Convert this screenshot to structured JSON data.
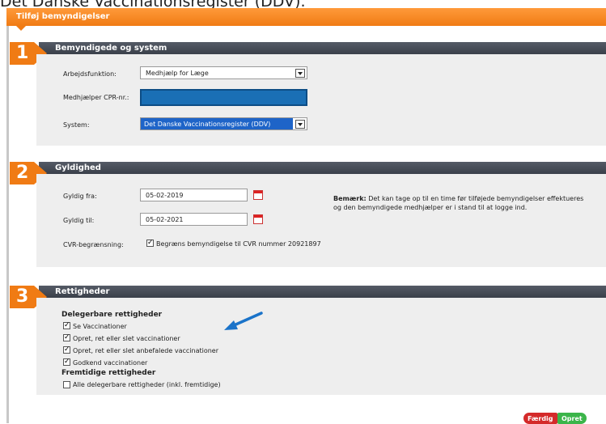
{
  "page_caption": "Det Danske Vaccinationsregister (DDV).",
  "dialog": {
    "title": "Tilføj bemyndigelser"
  },
  "section1": {
    "number": "1",
    "title": "Bemyndigede og system",
    "function_label": "Arbejdsfunktion:",
    "function_value": "Medhjælp for Læge",
    "cpr_label": "Medhjælper CPR-nr.:",
    "cpr_value": "",
    "system_label": "System:",
    "system_value": "Det Danske Vaccinationsregister (DDV)"
  },
  "section2": {
    "number": "2",
    "title": "Gyldighed",
    "from_label": "Gyldig fra:",
    "from_value": "05-02-2019",
    "to_label": "Gyldig til:",
    "to_value": "05-02-2021",
    "cvr_label": "CVR-begrænsning:",
    "cvr_checkbox_label": "Begræns bemyndigelse til CVR nummer 20921897",
    "cvr_checked": true,
    "note_bold": "Bemærk:",
    "note_text": "Det kan tage op til en time før tilføjede bemyndigelser effektueres",
    "note_text_2": "og den bemyndigede medhjælper er i stand til at logge ind."
  },
  "section3": {
    "number": "3",
    "title": "Rettigheder",
    "delegable_heading": "Delegerbare rettigheder",
    "delegable": [
      {
        "label": "Se Vaccinationer",
        "checked": true
      },
      {
        "label": "Opret, ret eller slet vaccinationer",
        "checked": true
      },
      {
        "label": "Opret, ret eller slet anbefalede vaccinationer",
        "checked": true
      },
      {
        "label": "Godkend vaccinationer",
        "checked": true
      }
    ],
    "future_heading": "Fremtidige rettigheder",
    "future": [
      {
        "label": "Alle delegerbare rettigheder (inkl. fremtidige)",
        "checked": false
      }
    ]
  },
  "buttons": {
    "done": "Færdig",
    "create": "Opret"
  },
  "colors": {
    "accent": "#f07b14",
    "header_dark": "#474d57",
    "panel": "#eeeeee",
    "cpr_field": "#1a6fb5",
    "select_highlight": "#1e64c8",
    "create_button": "#3bb54a",
    "done_button": "#d42a2a",
    "annotation_arrow": "#1a73c9"
  },
  "icons": {
    "calendar": "calendar-icon",
    "annotation": "arrow-annotation-icon"
  }
}
